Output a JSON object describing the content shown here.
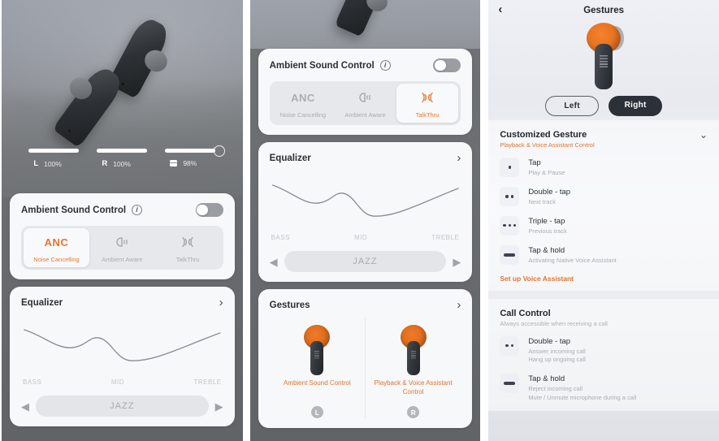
{
  "panel1": {
    "battery": [
      {
        "side": "L",
        "pct": "100%",
        "icon": "left-earbud"
      },
      {
        "side": "R",
        "pct": "100%",
        "icon": "right-earbud"
      },
      {
        "side": "",
        "pct": "98%",
        "icon": "charging-case"
      }
    ],
    "ambient": {
      "title": "Ambient Sound Control",
      "info_icon": "info-icon",
      "toggle_state": "off",
      "modes": [
        {
          "glyph": "ANC",
          "label": "Noise Cancelling",
          "active": true
        },
        {
          "glyph": "ambient-aware-icon",
          "label": "Ambient Aware",
          "active": false
        },
        {
          "glyph": "talkthru-icon",
          "label": "TalkThru",
          "active": false
        }
      ]
    },
    "equalizer": {
      "title": "Equalizer",
      "chevron": "chevron-right-icon",
      "axis": [
        "BASS",
        "MID",
        "TREBLE"
      ],
      "preset": "JAZZ",
      "prev_icon": "triangle-left-icon",
      "next_icon": "triangle-right-icon"
    }
  },
  "panel2": {
    "ambient": {
      "title": "Ambient Sound Control",
      "info_icon": "info-icon",
      "toggle_state": "off",
      "modes": [
        {
          "glyph": "ANC",
          "label": "Noise Cancelling",
          "active": false
        },
        {
          "glyph": "ambient-aware-icon",
          "label": "Ambient Aware",
          "active": false
        },
        {
          "glyph": "talkthru-icon",
          "label": "TalkThru",
          "active": true
        }
      ]
    },
    "equalizer": {
      "title": "Equalizer",
      "chevron": "chevron-right-icon",
      "axis": [
        "BASS",
        "MID",
        "TREBLE"
      ],
      "preset": "JAZZ",
      "prev_icon": "triangle-left-icon",
      "next_icon": "triangle-right-icon"
    },
    "gestures": {
      "title": "Gestures",
      "chevron": "chevron-right-icon",
      "items": [
        {
          "caption": "Ambient Sound Control",
          "badge": "L"
        },
        {
          "caption": "Playback & Voice Assistant Control",
          "badge": "R"
        }
      ]
    }
  },
  "panel3": {
    "nav": {
      "back_icon": "chevron-left-icon",
      "title": "Gestures"
    },
    "side_toggle": {
      "left": "Left",
      "right": "Right",
      "selected": "Right"
    },
    "customized": {
      "title": "Customized Gesture",
      "subtitle": "Playback & Voice Assistant Control",
      "chevron": "chevron-down-icon",
      "rows": [
        {
          "icon": "one-dot-icon",
          "dots": 1,
          "name": "Tap",
          "desc": "Play & Pause"
        },
        {
          "icon": "two-dots-icon",
          "dots": 2,
          "name": "Double - tap",
          "desc": "Next track"
        },
        {
          "icon": "three-dots-icon",
          "dots": 3,
          "name": "Triple - tap",
          "desc": "Previous track"
        },
        {
          "icon": "bar-icon",
          "dots": 0,
          "name": "Tap & hold",
          "desc": "Activating Native Voice Assistant"
        }
      ],
      "link": "Set up Voice Assistant"
    },
    "call_control": {
      "title": "Call Control",
      "subtitle": "Always accessible when receiving a call",
      "rows": [
        {
          "icon": "two-dots-icon",
          "dots": 2,
          "name": "Double - tap",
          "desc": "Answer incoming call\nHang up ongoing call"
        },
        {
          "icon": "bar-icon",
          "dots": 0,
          "name": "Tap & hold",
          "desc": "Reject incoming call\nMute / Unmute microphone during a call"
        }
      ]
    }
  },
  "colors": {
    "accent_orange": "#e8762e",
    "link_orange": "#dd7430",
    "dark_button": "#2b3039",
    "card_bg": "#f7f8fa"
  }
}
